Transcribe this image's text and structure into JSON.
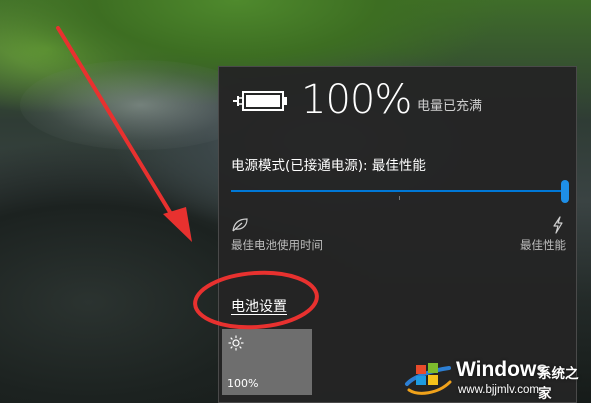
{
  "battery": {
    "percent_text": "100%",
    "status": "电量已充满",
    "level": 1.0
  },
  "power_mode": {
    "label": "电源模式(已接通电源): 最佳性能",
    "slider_value": 1.0,
    "left_caption": "最佳电池使用时间",
    "right_caption": "最佳性能",
    "left_icon": "leaf-icon",
    "right_icon": "lightning-icon"
  },
  "links": {
    "battery_settings": "电池设置"
  },
  "quick_action": {
    "icon": "brightness-icon",
    "value": "100%"
  },
  "annotations": {
    "arrow_color": "#e8312f",
    "circle_color": "#e8312f"
  },
  "watermark": {
    "brand": "Windows",
    "brand_cn": "系统之家",
    "url": "www.bjjmlv.com"
  },
  "colors": {
    "accent": "#0078d7",
    "flyout_bg": "#242424",
    "tile_bg": "#6e6e6e"
  }
}
